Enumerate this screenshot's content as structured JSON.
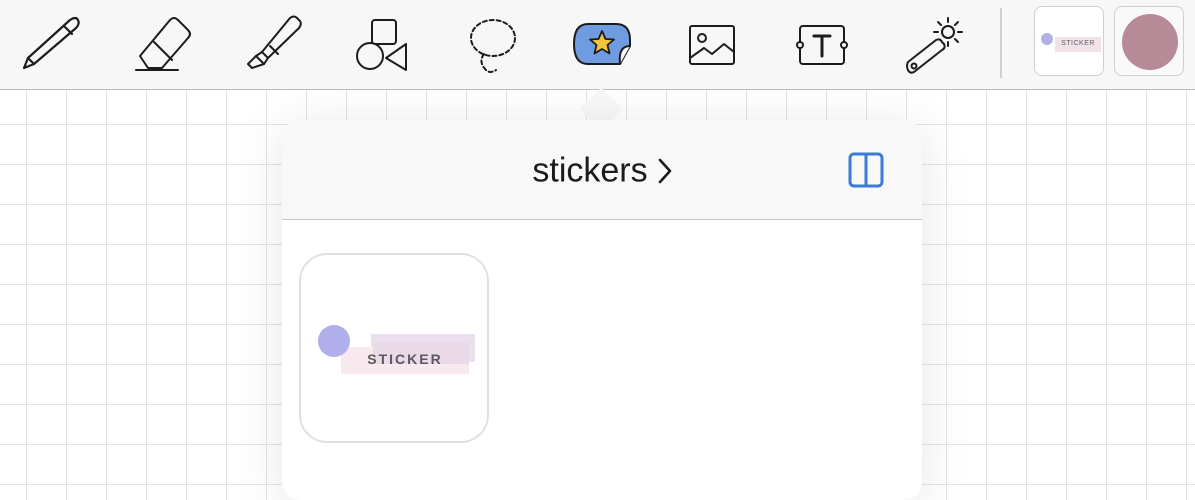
{
  "toolbar": {
    "tools": [
      {
        "name": "pen",
        "icon": "pen-icon"
      },
      {
        "name": "eraser",
        "icon": "eraser-icon"
      },
      {
        "name": "highlighter",
        "icon": "highlighter-icon"
      },
      {
        "name": "shapes",
        "icon": "shapes-icon"
      },
      {
        "name": "lasso",
        "icon": "lasso-icon"
      },
      {
        "name": "stickers",
        "icon": "sticker-star-icon",
        "selected": true
      },
      {
        "name": "image",
        "icon": "image-icon"
      },
      {
        "name": "text",
        "icon": "text-box-icon"
      },
      {
        "name": "laser-pointer",
        "icon": "laser-pointer-icon"
      }
    ],
    "presets": {
      "sticker_label": "STICKER",
      "color_swatch": "#b78a97"
    },
    "accent": "#6f9be0"
  },
  "popover": {
    "title": "stickers",
    "title_icon": "chevron-right-icon",
    "split_view_icon": "split-view-icon",
    "stickers": [
      {
        "label": "STICKER",
        "dot_color": "#b0aeeb"
      }
    ]
  }
}
